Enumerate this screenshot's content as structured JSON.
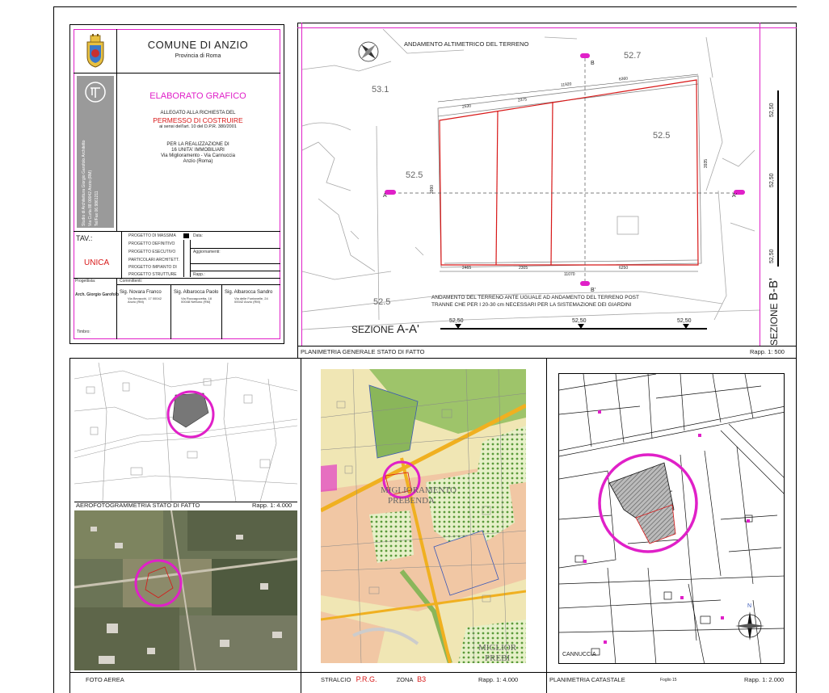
{
  "title_block": {
    "comune": "COMUNE DI ANZIO",
    "provincia": "Provincia di Roma",
    "elaborato": "ELABORATO GRAFICO",
    "allegato": "ALLEGATO ALLA RICHIESTA DEL",
    "permesso": "PERMESSO DI COSTRUIRE",
    "ai_sensi": "ai sensi dell'art. 10 del D.P.R. 380/2001",
    "realizzazione_1": "PER LA REALIZZAZIONE DI",
    "realizzazione_2": "16 UNITA' IMMOBILIARI",
    "realizzazione_3": "Via Miglioramento - Via Cannuccia",
    "realizzazione_4": "Anzio (Roma)",
    "studio_1": "Studio di Architettura Giorgio Garofolo Architetto",
    "studio_2": "Via Curta 88 00042 Anzio (RM)",
    "studio_3": "Tel/Fax 06.9861211",
    "tav_label": "TAV.:",
    "tav_value": "UNICA",
    "progetti": [
      "PROGETTO DI MASSIMA",
      "PROGETTO DEFINITIVO",
      "PROGETTO ESECUTIVO",
      "PARTICOLARI ARCHITETT.",
      "PROGETTO IMPIANTO DI",
      "PROGETTO STRUTTURE"
    ],
    "data_label": "Data:",
    "aggiornamenti_label": "Aggiornamenti:",
    "rapp_label": "Rapp.:",
    "progettista_label": "Progettista:",
    "committenti_label": "Committenti:",
    "progettista_name": "Arch. Giorgio Garofolo",
    "committenti": [
      {
        "name": "Sig. Novara Franco",
        "addr": "Via Bevacchi, 17 00042 Anzio (RM)"
      },
      {
        "name": "Sig. Albarocca Paolo",
        "addr": "Via Roccagovetta, 18 00048 Nettuno (RM)"
      },
      {
        "name": "Sig. Albarocca Sandro",
        "addr": "Via delle Fontanelle, 24 00042 Anzio (RM)"
      }
    ],
    "timbro": "Timbro:"
  },
  "planimetria": {
    "heading": "ANDAMENTO ALTIMETRICO DEL TERRENO",
    "elevations": [
      "52.7",
      "53.1",
      "52.5",
      "52.5",
      "52.5"
    ],
    "dims_top": [
      "11920",
      "6360",
      "2530",
      "2375"
    ],
    "dims_bottom": [
      "2465",
      "2305",
      "6250",
      "11070"
    ],
    "dim_left": "3990",
    "dim_right": "3935",
    "markers": [
      "A",
      "A'",
      "B",
      "B'"
    ],
    "note_1": "ANDAMENTO DEL TERRENO ANTE UGUALE AD ANDAMENTO DEL TERRENO POST",
    "note_2": "TRANNE CHE PER I 20-30 cm NECESSARI PER LA SISTEMAZIONE DEI GIARDINI",
    "sezione_aa_prefix": "SEZIONE ",
    "sezione_aa_name": "A-A'",
    "sezione_aa_levels": [
      "52,50",
      "52,50",
      "52,50"
    ],
    "sezione_bb_prefix": "SEZIONE ",
    "sezione_bb_name": "B-B'",
    "sezione_bb_levels": [
      "52,50",
      "52,50",
      "52,50"
    ],
    "caption": "PLANIMETRIA GENERALE STATO DI FATTO",
    "rapp": "Rapp. 1: 500"
  },
  "aerofoto": {
    "caption": "AEROFOTOGRAMMETRIA   STATO DI FATTO",
    "rapp": "Rapp. 1: 4.000"
  },
  "foto": {
    "caption": "FOTO AEREA"
  },
  "prg": {
    "caption_prefix": "STRALCIO",
    "caption_name": "P.R.G.",
    "zona_label": "ZONA",
    "zona_value": "B3",
    "rapp": "Rapp. 1: 4.000",
    "label_1": "MIGLIORAMENTO",
    "label_2": "PREBENDA",
    "label_3": "MIGLIOR",
    "label_4": "PREBI"
  },
  "catasto": {
    "caption": "PLANIMETRIA CATASTALE",
    "foglio": "Foglio 15",
    "rapp": "Rapp. 1: 2.000",
    "street": "CANNUCCIA",
    "north": "N"
  },
  "colors": {
    "accent": "#e020c8",
    "red": "#d81818",
    "line": "#000000"
  }
}
